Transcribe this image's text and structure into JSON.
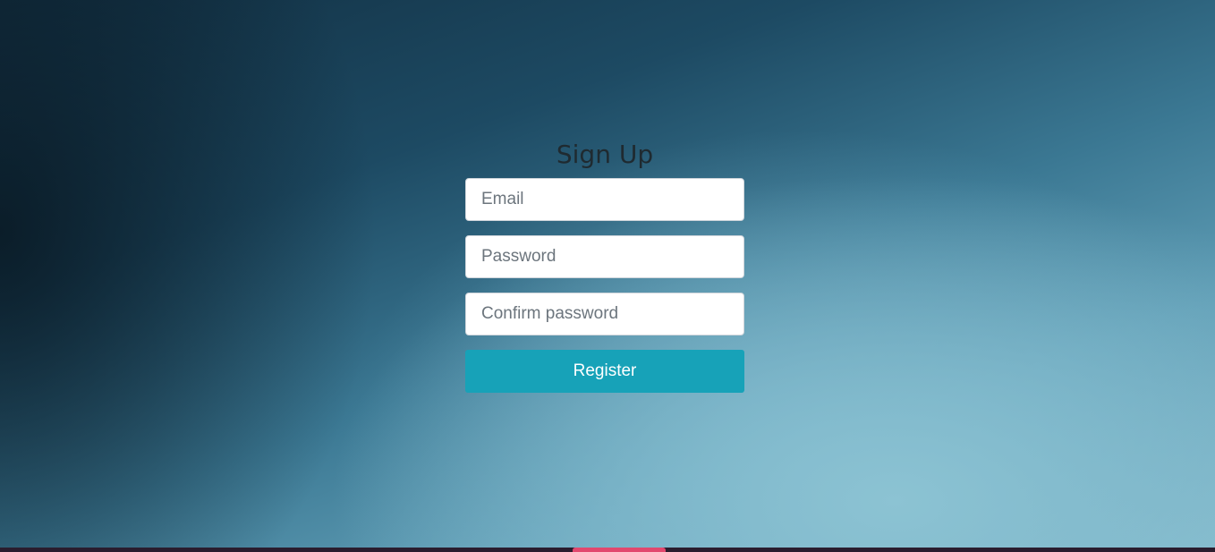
{
  "signup": {
    "title": "Sign Up",
    "email_placeholder": "Email",
    "password_placeholder": "Password",
    "confirm_placeholder": "Confirm password",
    "register_label": "Register"
  },
  "colors": {
    "button": "#17a2b8",
    "title": "#1f2a30",
    "taskbar_accent": "#e2486e"
  }
}
